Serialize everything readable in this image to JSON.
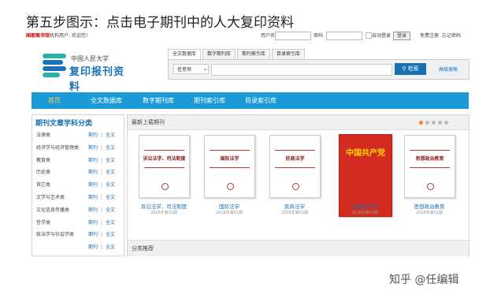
{
  "step_title": "第五步图示：点击电子期刊中的人大复印资料",
  "topbar": {
    "brand": "国家图书馆",
    "status": "机构用户: 欢迎您!",
    "username_label": "用户名",
    "password_label": "密码",
    "auto_login": "自动登录",
    "login_button": "登录",
    "register": "免费注册",
    "forgot": "忘记密码"
  },
  "logo": {
    "line1": "中国人民大学",
    "line2": "复印报刊资料"
  },
  "search": {
    "tabs": [
      "全文数据库",
      "数字期刊库",
      "期刊索引库",
      "目录索引库"
    ],
    "select_value": "任意项",
    "button": "检索",
    "advanced": "高级搜索"
  },
  "nav": {
    "items": [
      "首页",
      "全文数据库",
      "数字期刊库",
      "期刊索引库",
      "目录索引库"
    ]
  },
  "sidebar": {
    "title": "期刊文章学科分类",
    "journal_label": "期刊",
    "fulltext_label": "全文",
    "separator": "|",
    "categories": [
      "法律类",
      "经济学与经济管理类",
      "教育类",
      "历史类",
      "其它类",
      "文学与艺术类",
      "文化信息传播类",
      "哲学类",
      "政治学与社会学类",
      ""
    ]
  },
  "main": {
    "latest_title": "最新上载期刊",
    "recommend_title": "分类推荐",
    "journals": [
      {
        "cover": "诉讼法学、司法制度",
        "name": "诉讼法学、司法制度",
        "issue": "2018年第01期"
      },
      {
        "cover": "国际法学",
        "name": "国际法学",
        "issue": "2018年第01期"
      },
      {
        "cover": "民商法学",
        "name": "民商法学",
        "issue": "2018年第01期"
      },
      {
        "cover": "中国共产党",
        "name": "中国共产党",
        "issue": "2018年第01期"
      },
      {
        "cover": "思想政治教育",
        "name": "思想政治教育",
        "issue": "2018年第01期"
      }
    ]
  },
  "watermark": "知乎 @任编辑",
  "colors": {
    "nav_bg": "#1a9ad6",
    "accent": "#1a6fb0",
    "home_active": "#ffd24a",
    "red_cover": "#d32b20"
  }
}
